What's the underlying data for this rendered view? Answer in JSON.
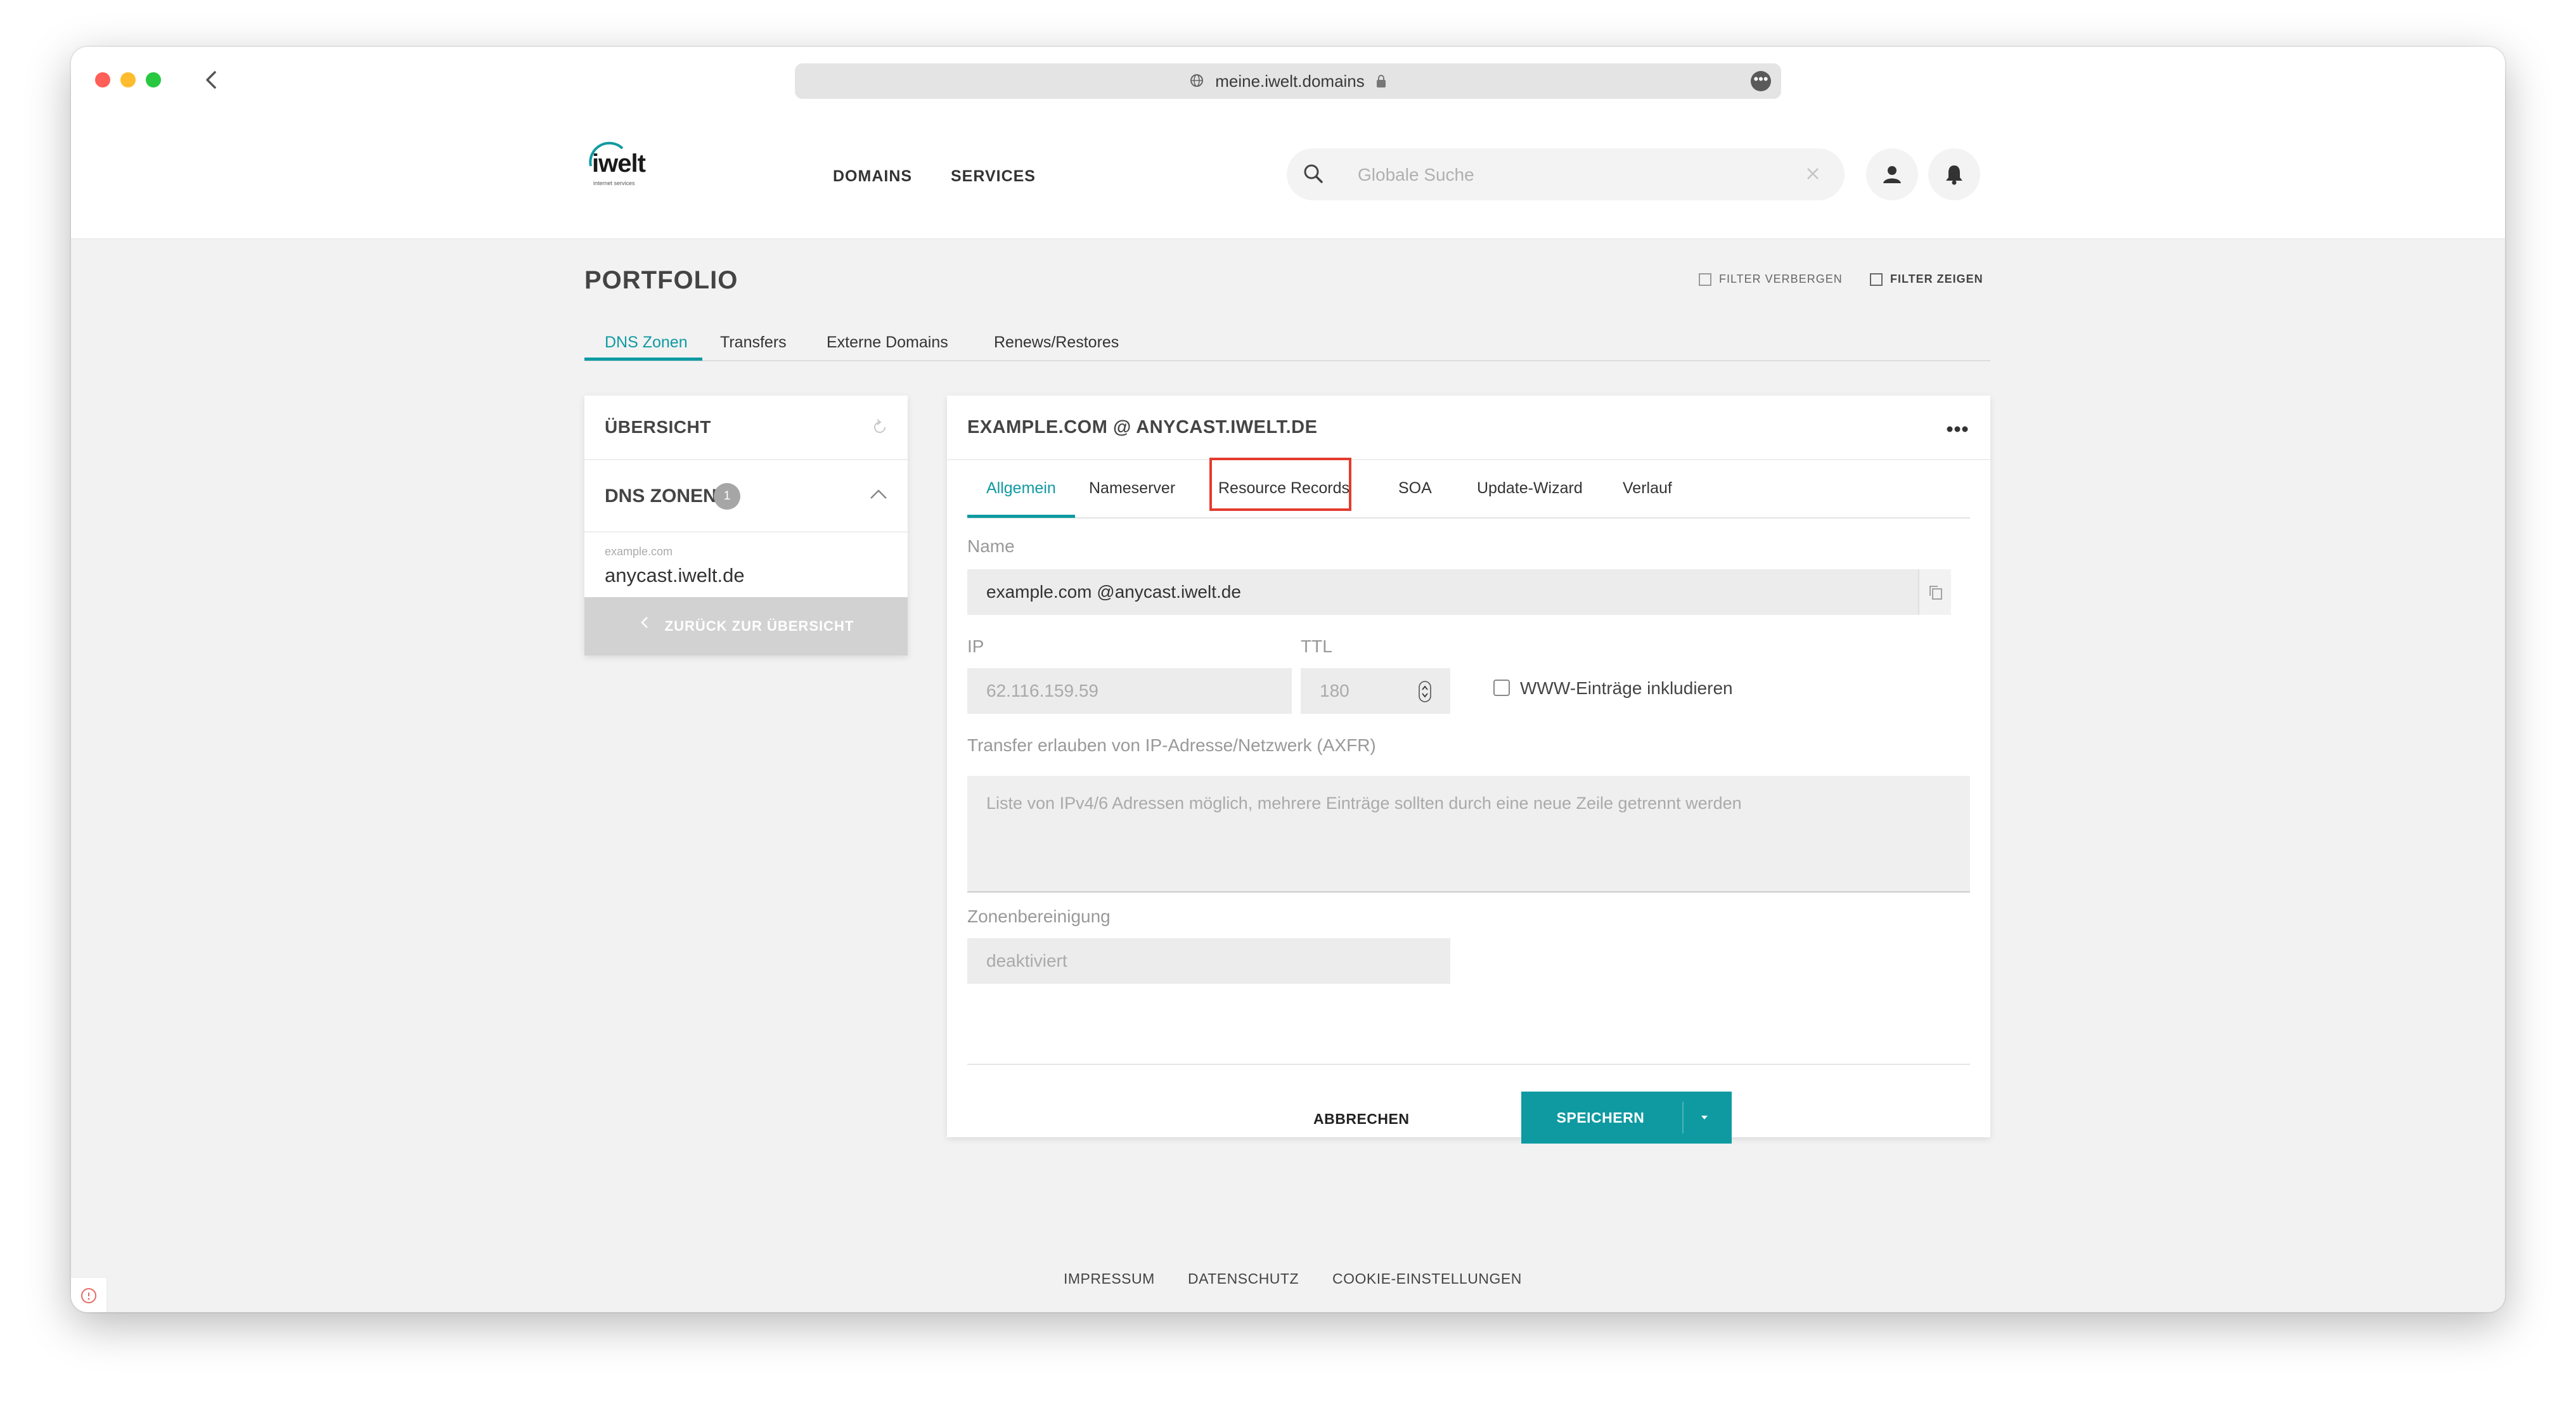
{
  "browser": {
    "url": "meine.iwelt.domains",
    "traffic_colors": [
      "#ff5f57",
      "#febc2e",
      "#28c840"
    ]
  },
  "header": {
    "logo_text": "iwelt",
    "logo_subtext": "internet services",
    "nav": [
      "DOMAINS",
      "SERVICES"
    ],
    "search_placeholder": "Globale Suche"
  },
  "page": {
    "title": "PORTFOLIO",
    "filter_hide": "FILTER VERBERGEN",
    "filter_show": "FILTER ZEIGEN",
    "tabs": [
      "DNS Zonen",
      "Transfers",
      "Externe Domains",
      "Renews/Restores"
    ],
    "active_tab": "DNS Zonen"
  },
  "sidebar": {
    "overview_title": "ÜBERSICHT",
    "section_title": "DNS ZONEN",
    "badge_count": "1",
    "item_small": "example.com",
    "item_main": "anycast.iwelt.de",
    "back_label": "ZURÜCK ZUR ÜBERSICHT"
  },
  "panel": {
    "title": "EXAMPLE.COM @ ANYCAST.IWELT.DE",
    "tabs": [
      "Allgemein",
      "Nameserver",
      "Resource Records",
      "SOA",
      "Update-Wizard",
      "Verlauf"
    ],
    "active_tab": "Allgemein",
    "highlighted_tab": "Resource Records",
    "name_label": "Name",
    "name_value": "example.com @anycast.iwelt.de",
    "ip_label": "IP",
    "ip_value": "62.116.159.59",
    "ttl_label": "TTL",
    "ttl_value": "180",
    "www_label": "WWW-Einträge inkludieren",
    "transfer_label": "Transfer erlauben von IP-Adresse/Netzwerk (AXFR)",
    "transfer_placeholder": "Liste von IPv4/6 Adressen möglich, mehrere Einträge sollten durch eine neue Zeile getrennt werden",
    "cleanup_label": "Zonenbereinigung",
    "cleanup_value": "deaktiviert",
    "cancel_label": "ABBRECHEN",
    "save_label": "SPEICHERN"
  },
  "footer": {
    "links": [
      "IMPRESSUM",
      "DATENSCHUTZ",
      "COOKIE-EINSTELLUNGEN"
    ]
  },
  "colors": {
    "accent": "#0f9aa2",
    "highlight": "#e43b2e"
  }
}
